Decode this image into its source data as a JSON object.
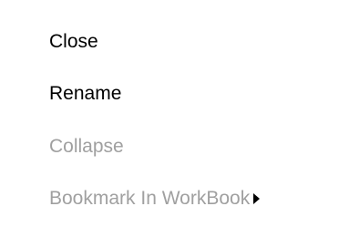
{
  "context_menu": {
    "items": [
      {
        "label": "Close",
        "enabled": true
      },
      {
        "label": "Rename",
        "enabled": true
      },
      {
        "label": "Collapse",
        "enabled": false
      },
      {
        "label": "Bookmark In WorkBook",
        "enabled": false,
        "has_submenu": true
      }
    ],
    "colors": {
      "enabled_text": "#000000",
      "disabled_text": "#a0a0a0",
      "background": "#ffffff",
      "submenu_arrow": "#000000"
    },
    "icons": {
      "submenu_arrow": "chevron-right-icon"
    }
  }
}
